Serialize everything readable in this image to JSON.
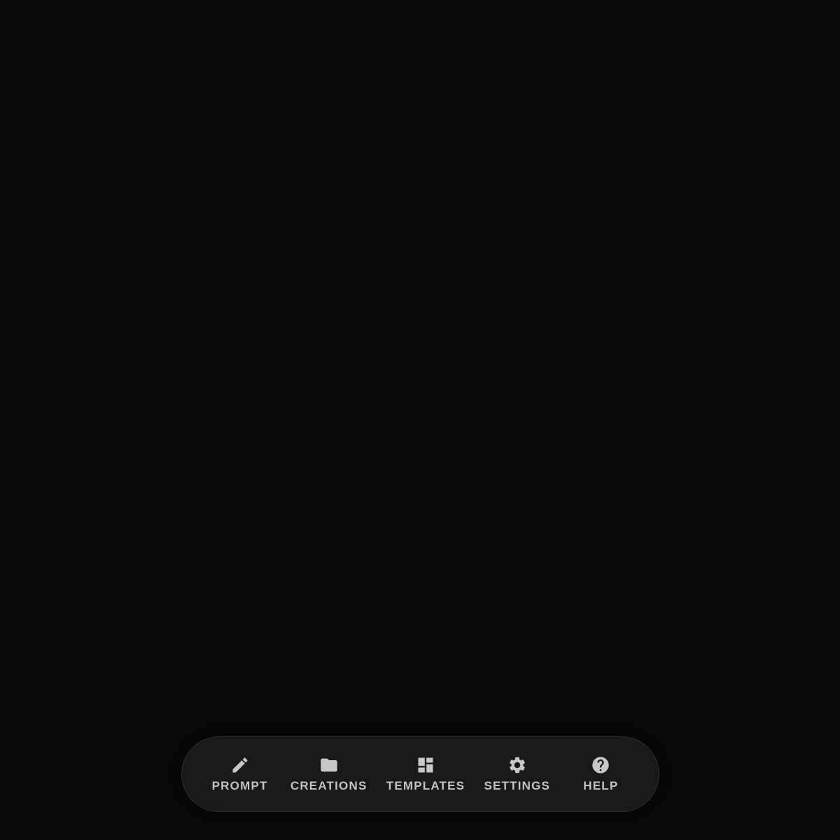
{
  "theme": {
    "background": "#0a0a0a",
    "dock_background": "#191919",
    "dock_border": "#2e2e2e",
    "icon_color": "#c8c8c8",
    "label_color": "#c4c4c4"
  },
  "dock": {
    "items": [
      {
        "label": "PROMPT",
        "icon": "pencil-icon"
      },
      {
        "label": "CREATIONS",
        "icon": "folder-icon"
      },
      {
        "label": "TEMPLATES",
        "icon": "dashboard-icon"
      },
      {
        "label": "SETTINGS",
        "icon": "gear-icon"
      },
      {
        "label": "HELP",
        "icon": "help-circle-icon"
      }
    ]
  }
}
